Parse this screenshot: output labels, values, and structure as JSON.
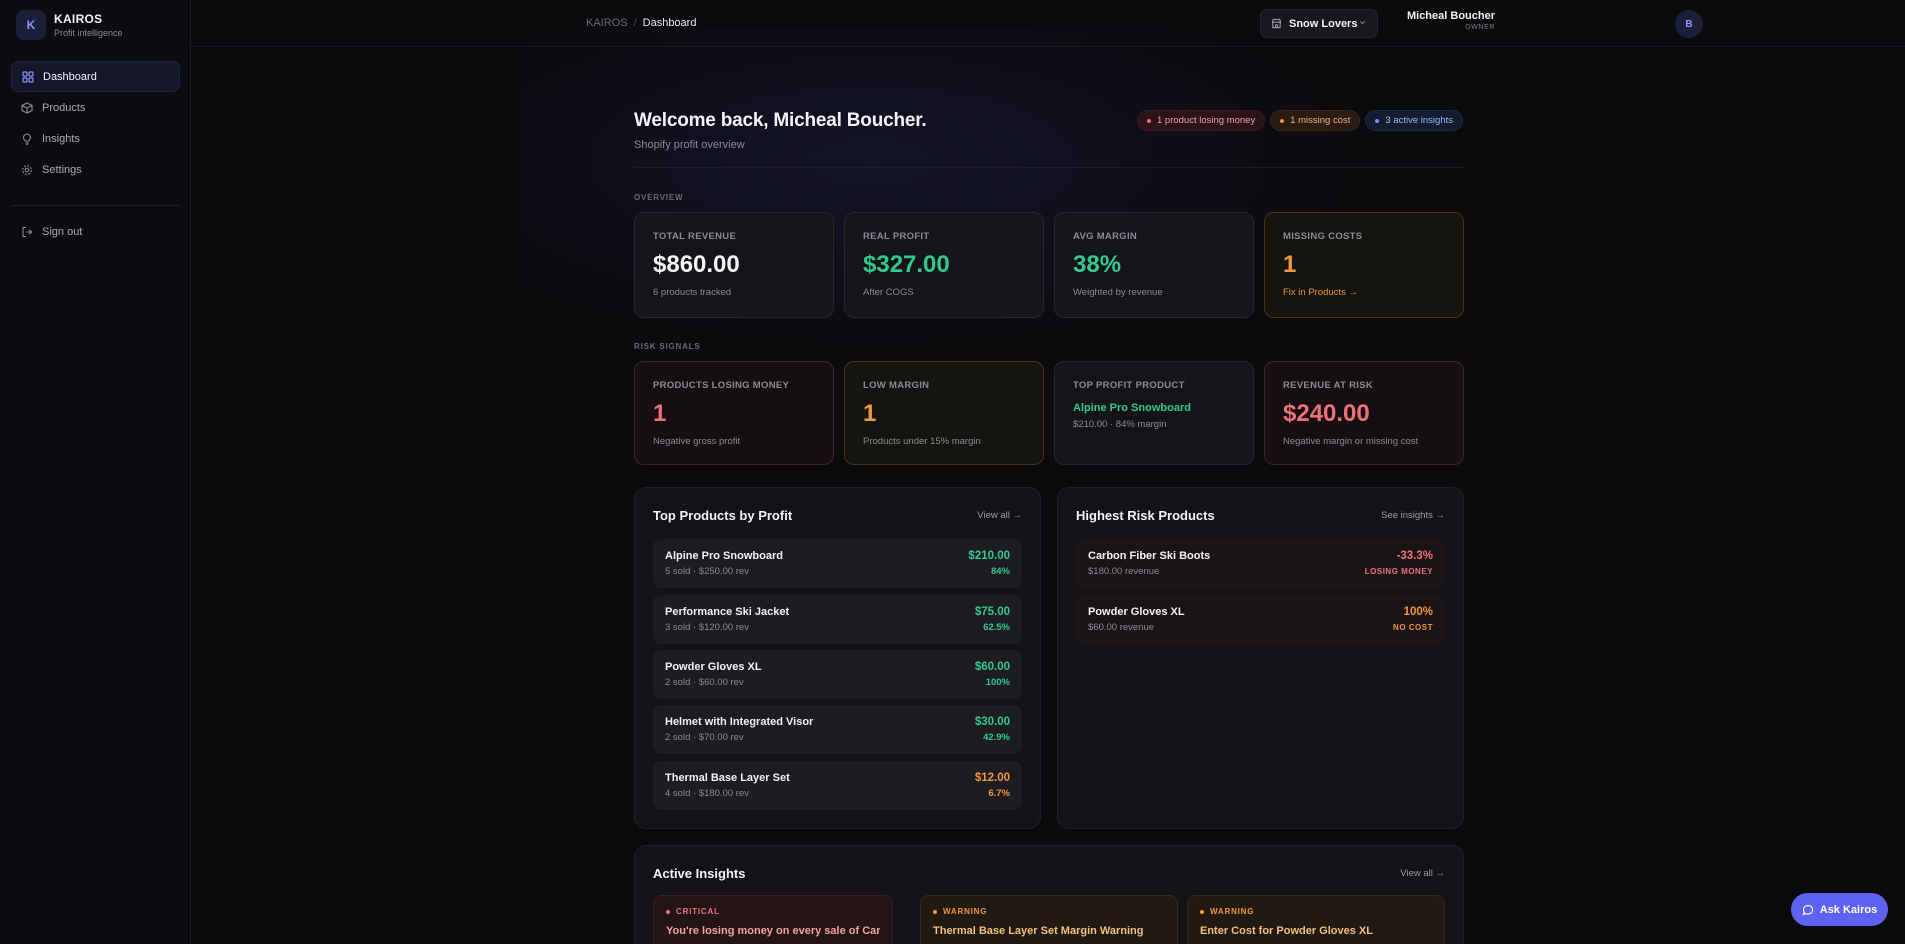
{
  "brand": {
    "logo_letter": "K",
    "name": "KAIROS",
    "subtitle": "Profit intelligence"
  },
  "nav": {
    "items": [
      {
        "label": "Dashboard",
        "icon": "grid-icon",
        "active": true
      },
      {
        "label": "Products",
        "icon": "box-icon"
      },
      {
        "label": "Insights",
        "icon": "lightbulb-icon"
      },
      {
        "label": "Settings",
        "icon": "gear-icon"
      }
    ],
    "signout": "Sign out"
  },
  "topbar": {
    "crumb_root": "KAIROS",
    "crumb_sep": "/",
    "crumb_current": "Dashboard",
    "store": "Snow Lovers",
    "user_name": "Micheal Boucher",
    "user_role": "OWNER",
    "avatar_letter": "B"
  },
  "welcome": {
    "title": "Welcome back, Micheal Boucher.",
    "subtitle": "Shopify profit overview",
    "pills": [
      "1 product losing money",
      "1 missing cost",
      "3 active insights"
    ]
  },
  "overview": {
    "label": "OVERVIEW",
    "cards": [
      {
        "label": "TOTAL REVENUE",
        "value": "$860.00",
        "sub": "6 products tracked"
      },
      {
        "label": "REAL PROFIT",
        "value": "$327.00",
        "sub": "After COGS"
      },
      {
        "label": "AVG MARGIN",
        "value": "38%",
        "sub": "Weighted by revenue"
      },
      {
        "label": "MISSING COSTS",
        "value": "1",
        "sub": "Fix in Products →"
      }
    ]
  },
  "risk": {
    "label": "RISK SIGNALS",
    "cards": [
      {
        "label": "PRODUCTS LOSING MONEY",
        "value": "1",
        "sub": "Negative gross profit"
      },
      {
        "label": "LOW MARGIN",
        "value": "1",
        "sub": "Products under 15% margin"
      },
      {
        "label": "TOP PROFIT PRODUCT",
        "value": "Alpine Pro Snowboard",
        "sub": "$210.00 · 84% margin"
      },
      {
        "label": "REVENUE AT RISK",
        "value": "$240.00",
        "sub": "Negative margin or missing cost"
      }
    ]
  },
  "top_products": {
    "title": "Top Products by Profit",
    "link": "View all →",
    "rows": [
      {
        "name": "Alpine Pro Snowboard",
        "sub": "5 sold · $250.00 rev",
        "value": "$210.00",
        "pct": "84%"
      },
      {
        "name": "Performance Ski Jacket",
        "sub": "3 sold · $120.00 rev",
        "value": "$75.00",
        "pct": "62.5%"
      },
      {
        "name": "Powder Gloves XL",
        "sub": "2 sold · $60.00 rev",
        "value": "$60.00",
        "pct": "100%"
      },
      {
        "name": "Helmet with Integrated Visor",
        "sub": "2 sold · $70.00 rev",
        "value": "$30.00",
        "pct": "42.9%"
      },
      {
        "name": "Thermal Base Layer Set",
        "sub": "4 sold · $180.00 rev",
        "value": "$12.00",
        "pct": "6.7%"
      }
    ]
  },
  "risk_products": {
    "title": "Highest Risk Products",
    "link": "See insights →",
    "rows": [
      {
        "name": "Carbon Fiber Ski Boots",
        "sub": "$180.00 revenue",
        "value": "-33.3%",
        "tag": "LOSING MONEY"
      },
      {
        "name": "Powder Gloves XL",
        "sub": "$60.00 revenue",
        "value": "100%",
        "tag": "NO COST"
      }
    ]
  },
  "insights": {
    "title": "Active Insights",
    "link": "View all →",
    "items": [
      {
        "tag": "CRITICAL",
        "title": "You're losing money on every sale of Carbon"
      },
      {
        "tag": "WARNING",
        "title": "Thermal Base Layer Set Margin Warning"
      },
      {
        "tag": "WARNING",
        "title": "Enter Cost for Powder Gloves XL"
      }
    ]
  },
  "ask_button": "Ask Kairos"
}
